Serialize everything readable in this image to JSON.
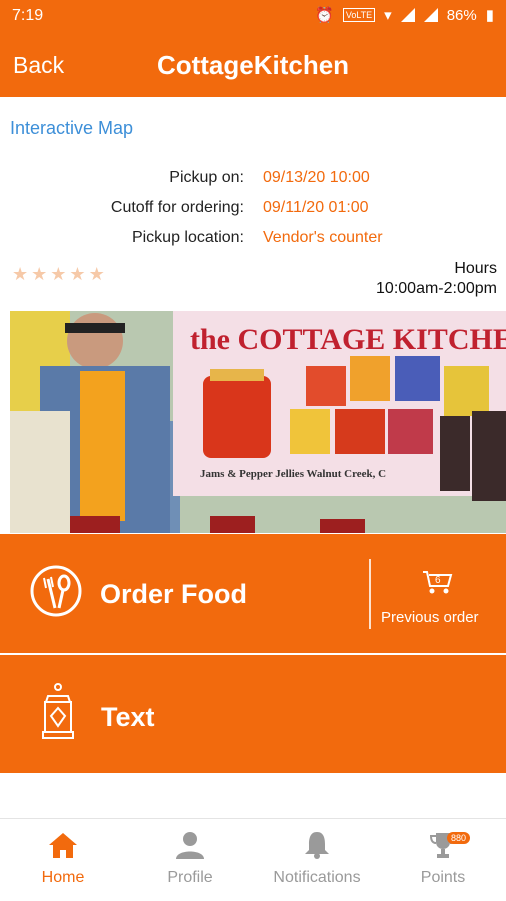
{
  "status_bar": {
    "time": "7:19",
    "network": "VoLTE",
    "battery": "86%"
  },
  "header": {
    "back_label": "Back",
    "title": "CottageKitchen"
  },
  "map_link": "Interactive Map",
  "details": [
    {
      "label": "Pickup on:",
      "value": "09/13/20 10:00"
    },
    {
      "label": "Cutoff for ordering:",
      "value": "09/11/20 01:00"
    },
    {
      "label": "Pickup location:",
      "value": "Vendor's counter"
    }
  ],
  "rating": {
    "stars_filled": 0,
    "stars_total": 5
  },
  "hours": {
    "label": "Hours",
    "value": "10:00am-2:00pm"
  },
  "photo": {
    "banner_text": "the COTTAGE KITCHEN",
    "caption": "Jams & Pepper Jellies   Walnut Creek, C"
  },
  "actions": {
    "order_food": "Order Food",
    "previous_order": "Previous order",
    "cart_count": "6",
    "text": "Text"
  },
  "nav": {
    "home": "Home",
    "profile": "Profile",
    "notifications": "Notifications",
    "points": "Points",
    "points_badge": "880"
  },
  "colors": {
    "brand": "#f26a0d",
    "link": "#3d8fd8"
  }
}
